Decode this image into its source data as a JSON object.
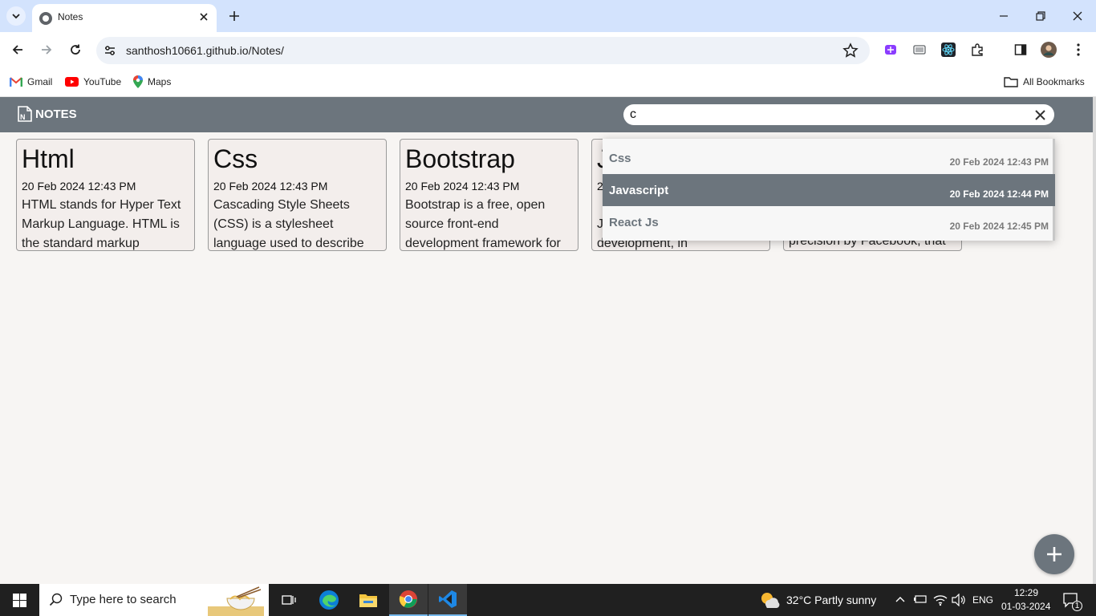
{
  "browser": {
    "tab_title": "Notes",
    "url": "santhosh10661.github.io/Notes/",
    "bookmarks": [
      {
        "label": "Gmail",
        "icon": "gmail-icon"
      },
      {
        "label": "YouTube",
        "icon": "youtube-icon"
      },
      {
        "label": "Maps",
        "icon": "maps-icon"
      }
    ],
    "all_bookmarks": "All Bookmarks"
  },
  "app": {
    "brand": "NOTES",
    "search_value": "c",
    "accent": "#6c757d",
    "notes": [
      {
        "title": "Html",
        "date": "20 Feb 2024 12:43 PM",
        "body": "HTML stands for Hyper Text Markup Language. HTML is the standard markup"
      },
      {
        "title": "Css",
        "date": "20 Feb 2024 12:43 PM",
        "body": "Cascading Style Sheets (CSS) is a stylesheet language used to describe the presentation"
      },
      {
        "title": "Bootstrap",
        "date": "20 Feb 2024 12:43 PM",
        "body": "Bootstrap is a free, open source front-end development framework for"
      },
      {
        "title": "J",
        "date": "2",
        "body": "Ja p used for web development, in"
      },
      {
        "title": "",
        "date": "",
        "body": "precision by Facebook, that"
      }
    ],
    "suggestions": [
      {
        "title": "Css",
        "date": "20 Feb 2024 12:43 PM",
        "active": false
      },
      {
        "title": "Javascript",
        "date": "20 Feb 2024 12:44 PM",
        "active": true
      },
      {
        "title": "React Js",
        "date": "20 Feb 2024 12:45 PM",
        "active": false
      }
    ]
  },
  "taskbar": {
    "search_placeholder": "Type here to search",
    "weather": "32°C  Partly sunny",
    "language": "ENG",
    "time": "12:29",
    "date": "01-03-2024",
    "notification_count": "1"
  }
}
